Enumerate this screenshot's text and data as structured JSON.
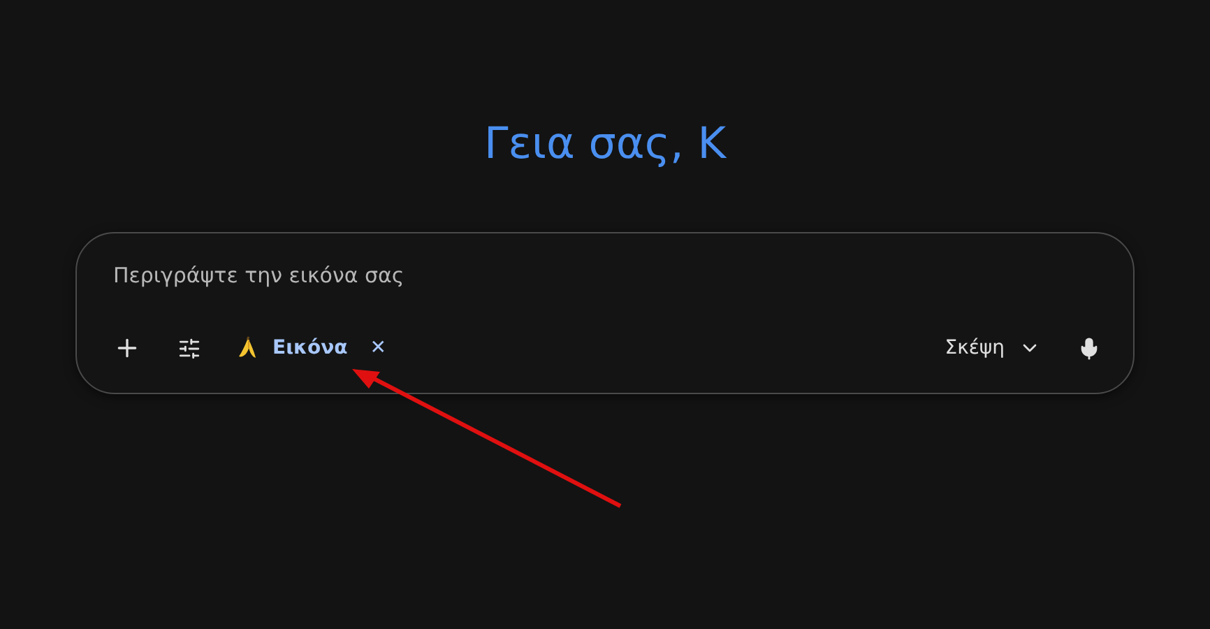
{
  "greeting": "Γεια σας, Κ",
  "prompt": {
    "placeholder": "Περιγράψτε την εικόνα σας"
  },
  "chip": {
    "label": "Εικόνα",
    "remove": "✕"
  },
  "mode": {
    "label": "Σκέψη"
  }
}
